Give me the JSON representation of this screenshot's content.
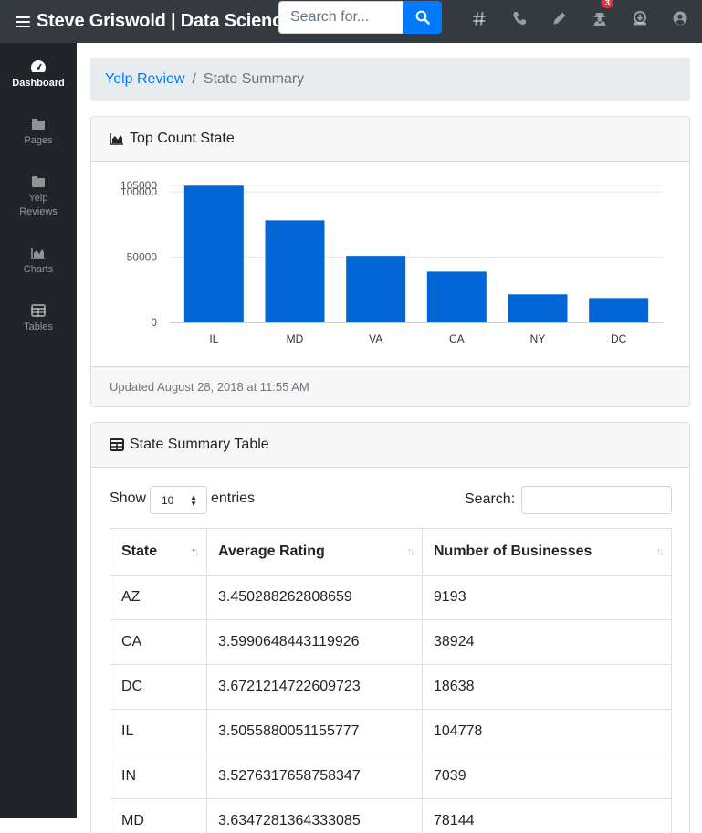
{
  "navbar": {
    "brand": "Steve Griswold | Data Science",
    "search_placeholder": "Search for...",
    "icons": [
      "hashtag-icon",
      "phone-icon",
      "pencil-icon",
      "user-secret-icon",
      "download-icon",
      "user-circle-icon"
    ],
    "notification_count": "3"
  },
  "sidebar": {
    "items": [
      {
        "label": "Dashboard",
        "icon": "tachometer-icon",
        "active": true
      },
      {
        "label": "Pages",
        "icon": "folder-icon"
      },
      {
        "label": "Yelp\nReviews",
        "label_line1": "Yelp",
        "label_line2": "Reviews",
        "icon": "folder-icon"
      },
      {
        "label": "Charts",
        "icon": "area-chart-icon"
      },
      {
        "label": "Tables",
        "icon": "table-icon"
      }
    ]
  },
  "breadcrumb": {
    "link": "Yelp Review",
    "current": "State Summary"
  },
  "chart_card": {
    "title": "Top Count State",
    "footer": "Updated August 28, 2018 at 11:55 AM"
  },
  "chart_data": {
    "type": "bar",
    "categories": [
      "IL",
      "MD",
      "VA",
      "CA",
      "NY",
      "DC"
    ],
    "values": [
      104778,
      78144,
      51000,
      38924,
      21500,
      18638
    ],
    "ylim": [
      0,
      105000
    ],
    "yticks": [
      "0",
      "50000",
      "100000",
      "105000"
    ],
    "bar_color": "#0066d6",
    "grid": true
  },
  "table_card": {
    "title": "State Summary Table",
    "show_label": "Show",
    "entries_value": "10",
    "entries_label": "entries",
    "search_label": "Search:",
    "columns": [
      "State",
      "Average Rating",
      "Number of Businesses"
    ],
    "rows": [
      [
        "AZ",
        "3.450288262808659",
        "9193"
      ],
      [
        "CA",
        "3.5990648443119926",
        "38924"
      ],
      [
        "DC",
        "3.6721214722609723",
        "18638"
      ],
      [
        "IL",
        "3.5055880051155777",
        "104778"
      ],
      [
        "IN",
        "3.5276317658758347",
        "7039"
      ],
      [
        "MD",
        "3.6347281364333085",
        "78144"
      ]
    ]
  },
  "colors": {
    "navbar": "#343a40",
    "sidebar": "#212529",
    "primary": "#007bff"
  }
}
